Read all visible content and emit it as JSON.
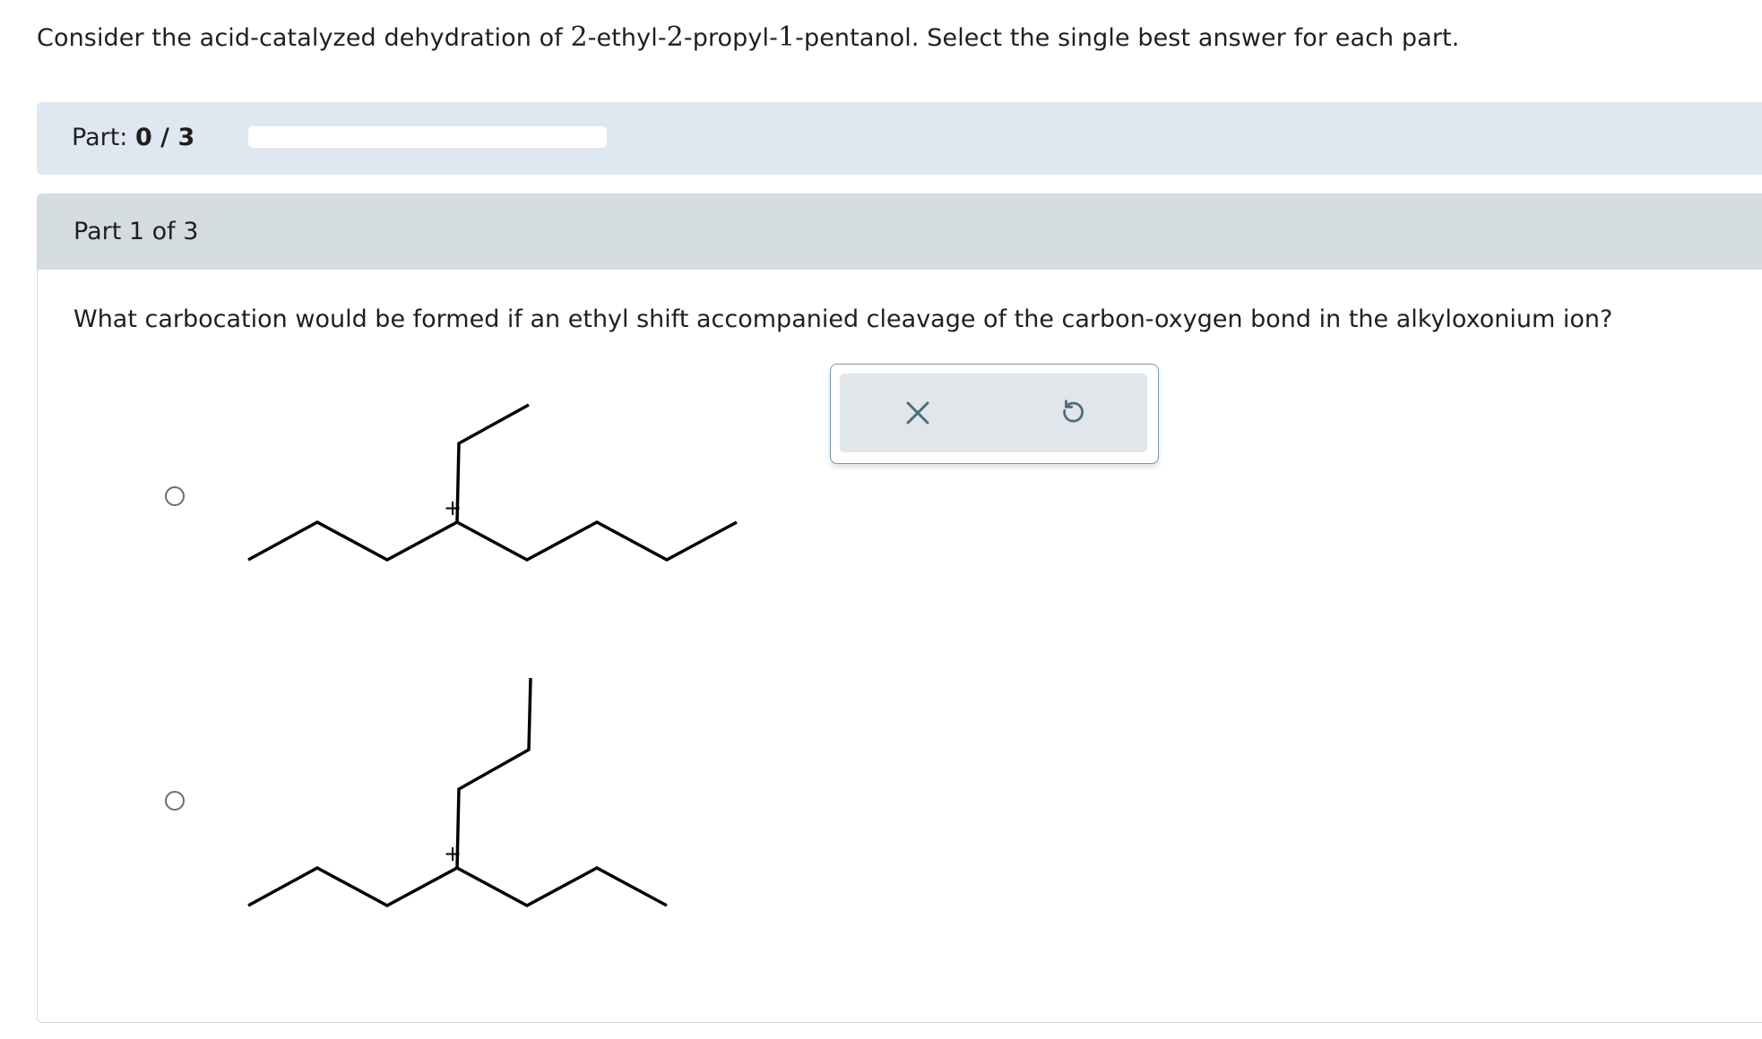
{
  "problem": {
    "text_before": "Consider the acid-catalyzed dehydration of ",
    "num1": "2",
    "text_mid1": "-ethyl-",
    "num2": "2",
    "text_mid2": "-propyl-",
    "num3": "1",
    "text_after": "-pentanol. Select the single best answer for each part."
  },
  "progress": {
    "label": "Part:",
    "value": "0 / 3",
    "fraction": 0
  },
  "part": {
    "title": "Part 1 of 3",
    "question": "What carbocation would be formed if an ethyl shift accompanied cleavage of the carbon-oxygen bond in the alkyloxonium ion?",
    "options": [
      {
        "charge_label": "+",
        "selected": false
      },
      {
        "charge_label": "+",
        "selected": false
      }
    ]
  },
  "toolbar": {
    "clear_icon": "x-icon",
    "reset_icon": "undo-icon"
  },
  "colors": {
    "progress_bar_bg": "#dfe8f0",
    "part_header_bg": "#d4dcdf",
    "tool_icon": "#4f6d7f"
  }
}
